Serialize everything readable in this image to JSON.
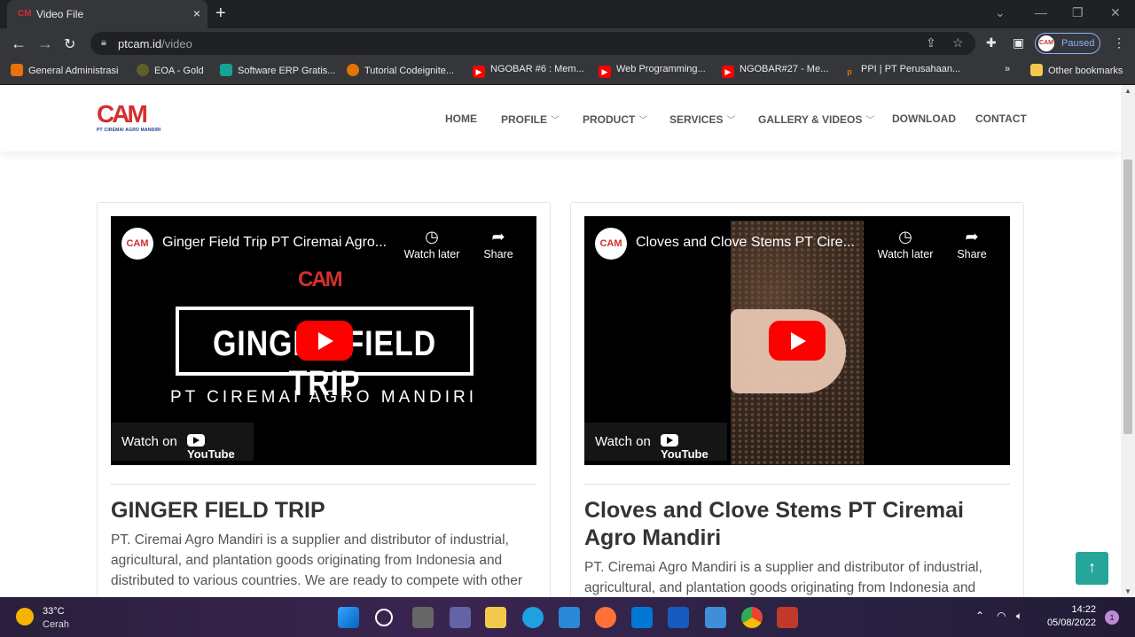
{
  "browser": {
    "tab_title": "Video File",
    "tab_close": "×",
    "new_tab": "+",
    "url_host": "ptcam.id",
    "url_path": "/video",
    "profile_status": "Paused",
    "profile_initials": "CAM",
    "bookmarks": [
      {
        "label": "General Administrasi",
        "color": "#e8710a"
      },
      {
        "label": "EOA - Gold",
        "color": "#5f5f2a"
      },
      {
        "label": "Software ERP Gratis...",
        "color": "#12a595"
      },
      {
        "label": "Tutorial Codeignite...",
        "color": "#e37400"
      },
      {
        "label": "NGOBAR #6 : Mem...",
        "color": "#ff0000"
      },
      {
        "label": "Web Programming...",
        "color": "#ff0000"
      },
      {
        "label": "NGOBAR#27 - Me...",
        "color": "#ff0000"
      },
      {
        "label": "PPI | PT Perusahaan...",
        "color": "#e8710a"
      }
    ],
    "bookmarks_overflow": "»",
    "other_bookmarks": "Other bookmarks"
  },
  "site": {
    "logo_mark": "CAM",
    "logo_sub": "PT CIREMAI AGRO MANDIRI",
    "nav": [
      {
        "label": "HOME",
        "dropdown": false
      },
      {
        "label": "PROFILE",
        "dropdown": true
      },
      {
        "label": "PRODUCT",
        "dropdown": true
      },
      {
        "label": "SERVICES",
        "dropdown": true
      },
      {
        "label": "GALLERY & VIDEOS",
        "dropdown": true
      },
      {
        "label": "DOWNLOAD",
        "dropdown": false
      },
      {
        "label": "CONTACT",
        "dropdown": false
      }
    ]
  },
  "videos": [
    {
      "video_title": "Ginger Field Trip PT Ciremai Agro...",
      "thumb_logo": "CAM",
      "thumb_text": "GINGER FIELD TRIP",
      "thumb_sub": "PT CIREMAI AGRO MANDIRI",
      "card_title": "GINGER FIELD TRIP",
      "card_desc": "PT. Ciremai Agro Mandiri is a supplier and distributor of industrial, agricultural, and plantation goods originating from Indonesia and distributed to various countries. We are ready to compete with other"
    },
    {
      "video_title": "Cloves and Clove Stems PT Cire...",
      "card_title": "Cloves and Clove Stems PT Ciremai Agro Mandiri",
      "card_desc": "PT. Ciremai Agro Mandiri is a supplier and distributor of industrial, agricultural, and plantation goods originating from Indonesia and"
    }
  ],
  "player": {
    "watch_later": "Watch later",
    "share": "Share",
    "watch_on": "Watch on",
    "youtube": "YouTube"
  },
  "taskbar": {
    "temperature": "33°C",
    "weather": "Cerah",
    "time": "14:22",
    "date": "05/08/2022",
    "notifications": "1"
  }
}
